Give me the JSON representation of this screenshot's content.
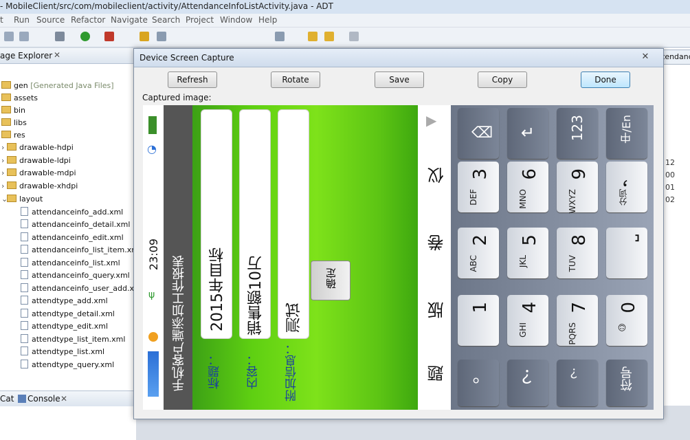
{
  "window": {
    "title": "- MobileClient/src/com/mobileclient/activity/AttendanceInfoListActivity.java - ADT"
  },
  "menu": [
    "t",
    "Run",
    "Source",
    "Refactor",
    "Navigate",
    "Search",
    "Project",
    "Window",
    "Help"
  ],
  "explorer": {
    "title": "age Explorer",
    "items": [
      {
        "label": "gen",
        "suffix": "[Generated Java Files]",
        "kind": "folder"
      },
      {
        "label": "assets",
        "kind": "folder"
      },
      {
        "label": "bin",
        "kind": "folder"
      },
      {
        "label": "libs",
        "kind": "folder"
      },
      {
        "label": "res",
        "kind": "folder"
      },
      {
        "label": "drawable-hdpi",
        "kind": "folder"
      },
      {
        "label": "drawable-ldpi",
        "kind": "folder"
      },
      {
        "label": "drawable-mdpi",
        "kind": "folder"
      },
      {
        "label": "drawable-xhdpi",
        "kind": "folder"
      },
      {
        "label": "layout",
        "kind": "folder"
      },
      {
        "label": "attendanceinfo_add.xml",
        "kind": "file"
      },
      {
        "label": "attendanceinfo_detail.xml",
        "kind": "file"
      },
      {
        "label": "attendanceinfo_edit.xml",
        "kind": "file"
      },
      {
        "label": "attendanceinfo_list_item.xml",
        "kind": "file"
      },
      {
        "label": "attendanceinfo_list.xml",
        "kind": "file"
      },
      {
        "label": "attendanceinfo_query.xml",
        "kind": "file"
      },
      {
        "label": "attendanceinfo_user_add.xn",
        "kind": "file"
      },
      {
        "label": "attendtype_add.xml",
        "kind": "file"
      },
      {
        "label": "attendtype_detail.xml",
        "kind": "file"
      },
      {
        "label": "attendtype_edit.xml",
        "kind": "file"
      },
      {
        "label": "attendtype_list_item.xml",
        "kind": "file"
      },
      {
        "label": "attendtype_list.xml",
        "kind": "file"
      },
      {
        "label": "attendtype_query.xml",
        "kind": "file"
      }
    ]
  },
  "bottom_tabs": {
    "cat": "Cat",
    "console": "Console"
  },
  "editor": {
    "tab": "tendanceLi",
    "lines": [
      "12",
      "00",
      "01",
      "02"
    ]
  },
  "dialog": {
    "title": "Device Screen Capture",
    "close": "✕",
    "buttons": {
      "refresh": "Refresh",
      "rotate": "Rotate",
      "save": "Save",
      "copy": "Copy",
      "done": "Done"
    },
    "captured_label": "Captured image:"
  },
  "phone": {
    "time": "23:09",
    "header": "手机客户端添加工作报表",
    "labels": {
      "title": "标题：",
      "content": "内容：",
      "extra": "附加信息："
    },
    "values": {
      "title": "2015年目标",
      "content": "销售额10万",
      "extra": "测试"
    },
    "ok": "确定",
    "candidates": [
      "仪",
      "卷",
      "版",
      "题"
    ],
    "keys": {
      "k1": {
        "num": "1",
        "let": ""
      },
      "k2": {
        "num": "2",
        "let": "ABC"
      },
      "k3": {
        "num": "3",
        "let": "DEF"
      },
      "k4": {
        "num": "4",
        "let": "GHI"
      },
      "k5": {
        "num": "5",
        "let": "JKL"
      },
      "k6": {
        "num": "6",
        "let": "MNO"
      },
      "k7": {
        "num": "7",
        "let": "PQRS"
      },
      "k8": {
        "num": "8",
        "let": "TUV"
      },
      "k9": {
        "num": "9",
        "let": "WXYZ"
      },
      "k0": {
        "num": "0",
        "let": "☺"
      },
      "comma": {
        "num": "，",
        "let": "分词"
      },
      "period": {
        "num": "。",
        "let": ""
      },
      "question": {
        "num": "？",
        "let": ""
      },
      "space": {
        "num": "⎵",
        "let": ""
      },
      "symbol": {
        "num": "符号",
        "let": ""
      },
      "num123": {
        "num": "123",
        "let": ""
      },
      "lang": {
        "num": "中/En",
        "let": ""
      }
    }
  }
}
